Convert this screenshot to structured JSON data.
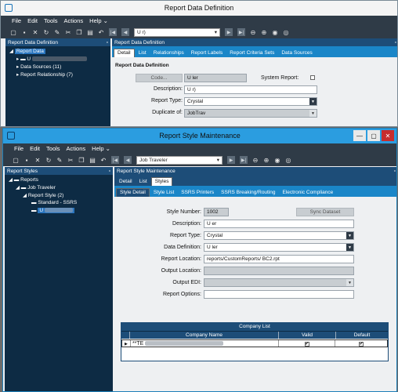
{
  "w1": {
    "title": "Report Data Definition",
    "menu": [
      "File",
      "Edit",
      "Tools",
      "Actions",
      "Help"
    ],
    "nav_combo": "U                          r)",
    "left_panel_title": "Report Data Definition",
    "right_panel_title": "Report Data Definition",
    "tree": {
      "root": "Report Data",
      "child1": "U",
      "child2": "Data Sources (11)",
      "child3": "Report Relationship (7)"
    },
    "tabs": [
      "Detail",
      "List",
      "Relationships",
      "Report Labels",
      "Report Criteria Sets",
      "Data Sources"
    ],
    "section_title": "Report Data Definition",
    "code_btn": "Code...",
    "code_value": "U              ler",
    "system_report_label": "System Report:",
    "description_label": "Description:",
    "description_value": "U                             r)",
    "report_type_label": "Report Type:",
    "report_type_value": "Crystal",
    "duplicate_label": "Duplicate of:",
    "duplicate_value": "JobTrav"
  },
  "w2": {
    "title": "Report Style Maintenance",
    "menu": [
      "File",
      "Edit",
      "Tools",
      "Actions",
      "Help"
    ],
    "nav_combo": "Job Traveler",
    "left_panel_title": "Report Styles",
    "right_panel_title": "Report Style Maintenance",
    "tree": {
      "root": "Reports",
      "child1": "Job Traveler",
      "child2": "Report Style (2)",
      "child3": "Standard - SSRS",
      "child4": "U"
    },
    "top_tabs": [
      "Detail",
      "List",
      "Styles"
    ],
    "sub_tabs": [
      "Style Detail",
      "Style List",
      "SSRS Printers",
      "SSRS Breaking/Routing",
      "Electronic Compliance"
    ],
    "style_number_label": "Style Number:",
    "style_number_value": "1002",
    "sync_btn": "Sync Dataset",
    "description_label": "Description:",
    "description_value": "U              er",
    "report_type_label": "Report Type:",
    "report_type_value": "Crystal",
    "data_def_label": "Data Definition:",
    "data_def_value": "U              ler",
    "report_loc_label": "Report Location:",
    "report_loc_value": "reports/CustomReports/               BC2.rpt",
    "output_loc_label": "Output Location:",
    "output_edi_label": "Output EDI:",
    "report_options_label": "Report Options:",
    "company_list_title": "Company List",
    "grid_headers": [
      "Company Name",
      "Valid",
      "Default"
    ],
    "grid_row_company": "**TE"
  }
}
